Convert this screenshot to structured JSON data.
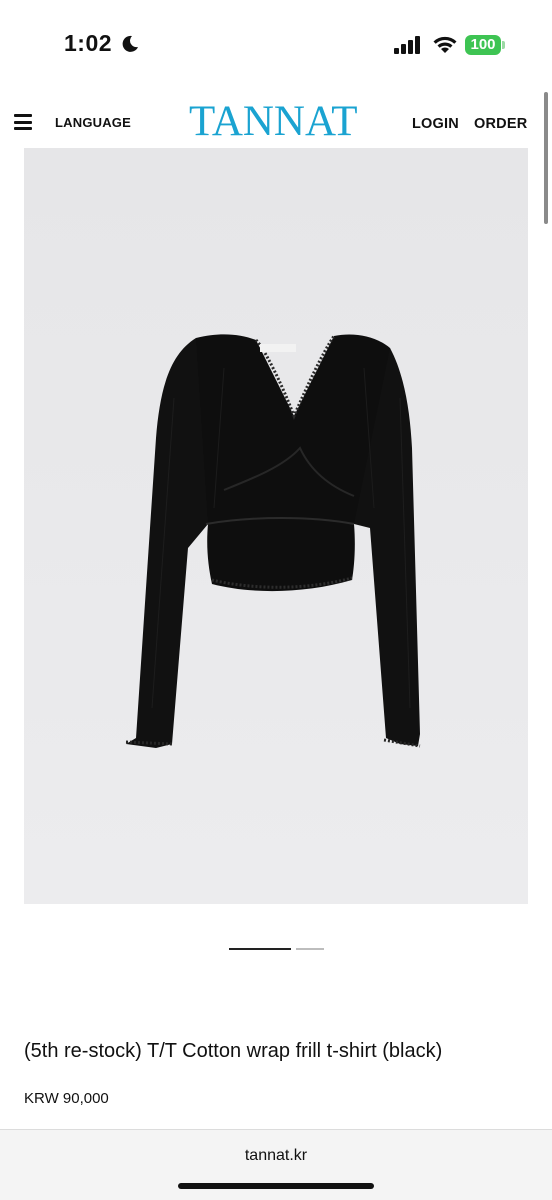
{
  "status_bar": {
    "time": "1:02",
    "battery": "100",
    "icons": [
      "moon-icon",
      "signal-icon",
      "wifi-icon",
      "battery-icon"
    ]
  },
  "header": {
    "menu_icon": "hamburger-menu-icon",
    "language": "LANGUAGE",
    "brand": "TANNAT",
    "login": "LOGIN",
    "order": "ORDER"
  },
  "product": {
    "image_alt": "black long sleeve wrap top",
    "title": "(5th re-stock) T/T Cotton wrap frill t-shirt (black)",
    "price": "KRW 90,000"
  },
  "carousel": {
    "total_slides": 2,
    "active_index": 0
  },
  "browser": {
    "url": "tannat.kr"
  },
  "colors": {
    "brand": "#1aa3d1",
    "battery": "#3ec453",
    "image_bg": "#e9e9eb",
    "garment": "#0e0e0e"
  }
}
